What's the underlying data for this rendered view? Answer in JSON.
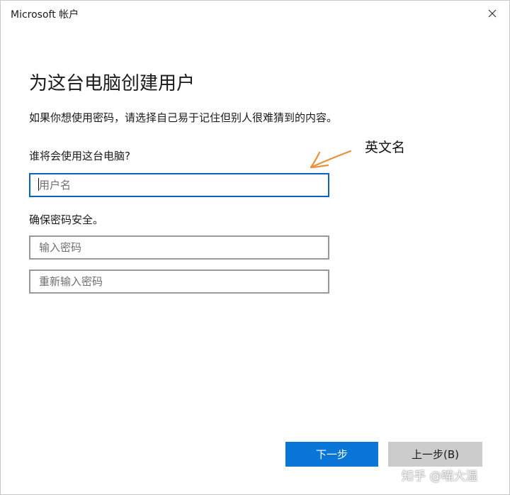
{
  "window": {
    "title": "Microsoft 帐户",
    "close_icon": "close-icon"
  },
  "main": {
    "heading": "为这台电脑创建用户",
    "description": "如果你想使用密码，请选择自己易于记住但别人很难猜到的内容。",
    "user_label": "谁将会使用这台电脑?",
    "username_placeholder": "用户名",
    "username_value": "",
    "password_label": "确保密码安全。",
    "password_placeholder": "输入密码",
    "password_confirm_placeholder": "重新输入密码"
  },
  "annotation": {
    "text": "英文名",
    "arrow_icon": "hand-drawn-arrow-icon",
    "arrow_color": "#e9913a"
  },
  "buttons": {
    "next_label": "下一步",
    "back_label": "上一步(B)"
  },
  "watermark": {
    "text": "知乎 @喵大湿"
  },
  "colors": {
    "accent": "#0a77d8",
    "focus_border": "#0a63c4",
    "secondary_button": "#cccccc",
    "field_border": "#999999"
  }
}
